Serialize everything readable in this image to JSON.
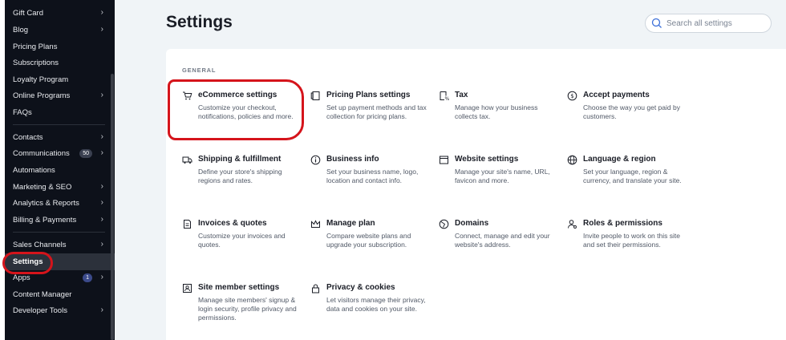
{
  "sidebar": {
    "items": [
      {
        "label": "Gift Card",
        "chevron": true
      },
      {
        "label": "Blog",
        "chevron": true
      },
      {
        "label": "Pricing Plans",
        "chevron": false
      },
      {
        "label": "Subscriptions",
        "chevron": false
      },
      {
        "label": "Loyalty Program",
        "chevron": false
      },
      {
        "label": "Online Programs",
        "chevron": true
      },
      {
        "label": "FAQs",
        "chevron": false
      },
      {
        "label": "Contacts",
        "chevron": true
      },
      {
        "label": "Communications",
        "chevron": true,
        "badge": "50"
      },
      {
        "label": "Automations",
        "chevron": false
      },
      {
        "label": "Marketing & SEO",
        "chevron": true
      },
      {
        "label": "Analytics & Reports",
        "chevron": true
      },
      {
        "label": "Billing & Payments",
        "chevron": true
      },
      {
        "label": "Sales Channels",
        "chevron": true
      },
      {
        "label": "Settings",
        "chevron": false,
        "active": true
      },
      {
        "label": "Apps",
        "chevron": true,
        "badge": "1"
      },
      {
        "label": "Content Manager",
        "chevron": false
      },
      {
        "label": "Developer Tools",
        "chevron": true
      }
    ]
  },
  "main": {
    "title": "Settings",
    "search_placeholder": "Search all settings",
    "section_label": "GENERAL",
    "tiles": [
      {
        "icon": "cart-icon",
        "title": "eCommerce settings",
        "desc": "Customize your checkout, notifications, policies and more."
      },
      {
        "icon": "pricing-plans-icon",
        "title": "Pricing Plans settings",
        "desc": "Set up payment methods and tax collection for pricing plans."
      },
      {
        "icon": "tax-icon",
        "title": "Tax",
        "desc": "Manage how your business collects tax."
      },
      {
        "icon": "payments-icon",
        "title": "Accept payments",
        "desc": "Choose the way you get paid by customers."
      },
      {
        "icon": "truck-icon",
        "title": "Shipping & fulfillment",
        "desc": "Define your store's shipping regions and rates."
      },
      {
        "icon": "info-icon",
        "title": "Business info",
        "desc": "Set your business name, logo, location and contact info."
      },
      {
        "icon": "browser-window-icon",
        "title": "Website settings",
        "desc": "Manage your site's name, URL, favicon and more."
      },
      {
        "icon": "globe-icon",
        "title": "Language & region",
        "desc": "Set your language, region & currency, and translate your site."
      },
      {
        "icon": "invoice-icon",
        "title": "Invoices & quotes",
        "desc": "Customize your invoices and quotes."
      },
      {
        "icon": "crown-icon",
        "title": "Manage plan",
        "desc": "Compare website plans and upgrade your subscription."
      },
      {
        "icon": "domain-icon",
        "title": "Domains",
        "desc": "Connect, manage and edit your website's address."
      },
      {
        "icon": "roles-icon",
        "title": "Roles & permissions",
        "desc": "Invite people to work on this site and set their permissions."
      },
      {
        "icon": "member-icon",
        "title": "Site member settings",
        "desc": "Manage site members' signup & login security, profile privacy and permissions."
      },
      {
        "icon": "lock-icon",
        "title": "Privacy & cookies",
        "desc": "Let visitors manage their privacy, data and cookies on your site."
      }
    ]
  },
  "colors": {
    "sidebar_bg": "#0d111a",
    "accent_annotation": "#d5141b",
    "page_bg": "#f0f4f7"
  }
}
